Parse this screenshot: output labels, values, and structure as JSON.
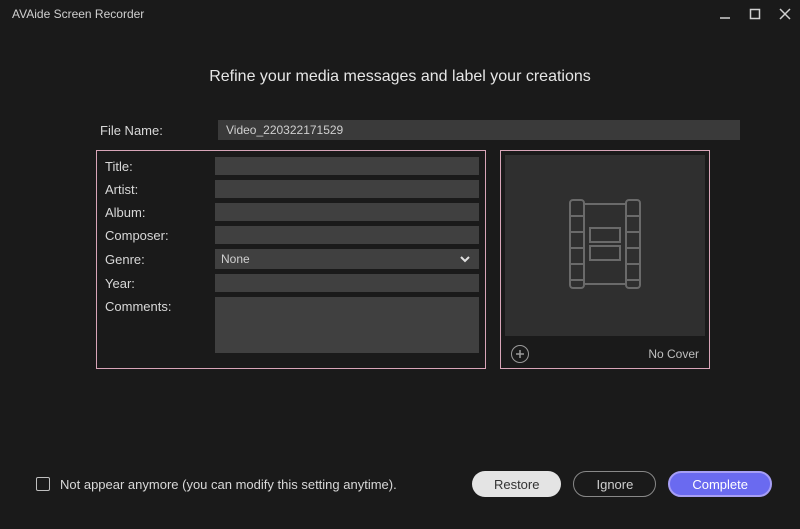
{
  "app": {
    "title": "AVAide Screen Recorder"
  },
  "heading": "Refine your media messages and label your creations",
  "filename": {
    "label": "File Name:",
    "value": "Video_220322171529"
  },
  "meta": {
    "title_label": "Title:",
    "artist_label": "Artist:",
    "album_label": "Album:",
    "composer_label": "Composer:",
    "genre_label": "Genre:",
    "genre_value": "None",
    "year_label": "Year:",
    "comments_label": "Comments:",
    "title_value": "",
    "artist_value": "",
    "album_value": "",
    "composer_value": "",
    "year_value": "",
    "comments_value": ""
  },
  "cover": {
    "no_cover_label": "No Cover"
  },
  "footer": {
    "checkbox_label": "Not appear anymore (you can modify this setting anytime).",
    "restore": "Restore",
    "ignore": "Ignore",
    "complete": "Complete"
  }
}
